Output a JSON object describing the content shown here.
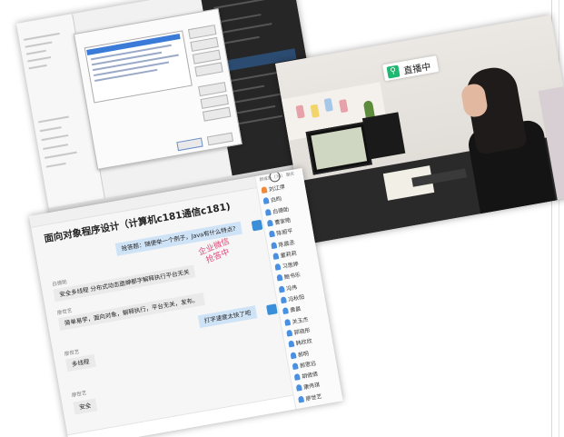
{
  "live_badge": {
    "icon": "search-icon",
    "text": "直播中",
    "color": "#1fb872"
  },
  "chat": {
    "title": "面向对象程序设计（计算机c181通信c181)",
    "stamp_line1": "企业微信",
    "stamp_line2": "抢答中",
    "messages": [
      {
        "sender": "",
        "text": "抢答题：随便举一个例子，Java有什么特点?",
        "self": true
      },
      {
        "sender": "白德助",
        "text": "安全多线程 分布式动态面蝉都字解释执行平台无关",
        "self": false
      },
      {
        "sender": "廖世艺",
        "text": "简单易学，面向对象，解释执行，平台无关，发布。",
        "self": false
      },
      {
        "sender": "",
        "text": "打字速度太快了吧",
        "self": true
      },
      {
        "sender": "廖世艺",
        "text": "多线程",
        "self": false
      },
      {
        "sender": "廖世艺",
        "text": "安全",
        "self": false
      }
    ],
    "members_header": "群成员（70）  聊天",
    "members": [
      "刘江萍",
      "白昀",
      "白德助",
      "曹家皓",
      "陈丽平",
      "陈晨丞",
      "董莉莉",
      "习思婷",
      "鲍书乐",
      "冯伟",
      "冯秋阳",
      "黄晨",
      "关玉杰",
      "郭晓彤",
      "韩欣欣",
      "郝明",
      "郝思远",
      "胡倩倩",
      "康伟琪",
      "廖世艺"
    ],
    "colors": {
      "self_bubble": "#cfe3f7",
      "other_bubble": "#eaeaea",
      "stamp": "#e04a7a",
      "avatar": "#3a8fd8"
    }
  }
}
